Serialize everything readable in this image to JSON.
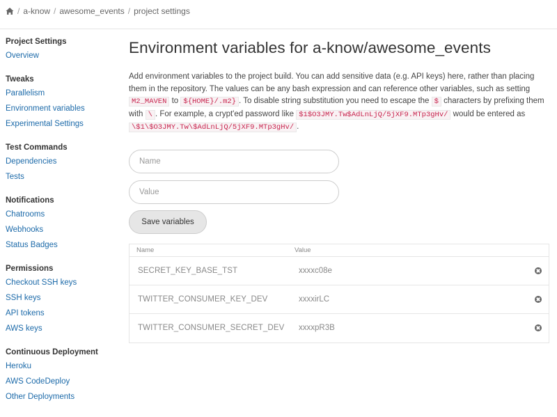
{
  "breadcrumb": {
    "items": [
      "a-know",
      "awesome_events",
      "project settings"
    ]
  },
  "sidebar": {
    "sections": [
      {
        "heading": "Project Settings",
        "items": [
          "Overview"
        ]
      },
      {
        "heading": "Tweaks",
        "items": [
          "Parallelism",
          "Environment variables",
          "Experimental Settings"
        ]
      },
      {
        "heading": "Test Commands",
        "items": [
          "Dependencies",
          "Tests"
        ]
      },
      {
        "heading": "Notifications",
        "items": [
          "Chatrooms",
          "Webhooks",
          "Status Badges"
        ]
      },
      {
        "heading": "Permissions",
        "items": [
          "Checkout SSH keys",
          "SSH keys",
          "API tokens",
          "AWS keys"
        ]
      },
      {
        "heading": "Continuous Deployment",
        "items": [
          "Heroku",
          "AWS CodeDeploy",
          "Other Deployments"
        ]
      }
    ]
  },
  "main": {
    "title": "Environment variables for a-know/awesome_events",
    "desc": {
      "t1": "Add environment variables to the project build. You can add sensitive data (e.g. API keys) here, rather than placing them in the repository. The values can be any bash expression and can reference other variables, such as setting ",
      "c1": "M2_MAVEN",
      "t2": " to ",
      "c2": "${HOME}/.m2}",
      "t3": ". To disable string substitution you need to escape the ",
      "c3": "$",
      "t4": " characters by prefixing them with ",
      "c4": "\\",
      "t5": ". For example, a crypt'ed password like ",
      "c5": "$1$O3JMY.Tw$AdLnLjQ/5jXF9.MTp3gHv/",
      "t6": " would be entered as ",
      "c6": "\\$1\\$O3JMY.Tw\\$AdLnLjQ/5jXF9.MTp3gHv/",
      "t7": "."
    },
    "form": {
      "name_placeholder": "Name",
      "value_placeholder": "Value",
      "save_label": "Save variables"
    },
    "table": {
      "headers": {
        "name": "Name",
        "value": "Value"
      },
      "rows": [
        {
          "name": "SECRET_KEY_BASE_TST",
          "value": "xxxxc08e"
        },
        {
          "name": "TWITTER_CONSUMER_KEY_DEV",
          "value": "xxxxirLC"
        },
        {
          "name": "TWITTER_CONSUMER_SECRET_DEV",
          "value": "xxxxpR3B"
        }
      ]
    }
  }
}
